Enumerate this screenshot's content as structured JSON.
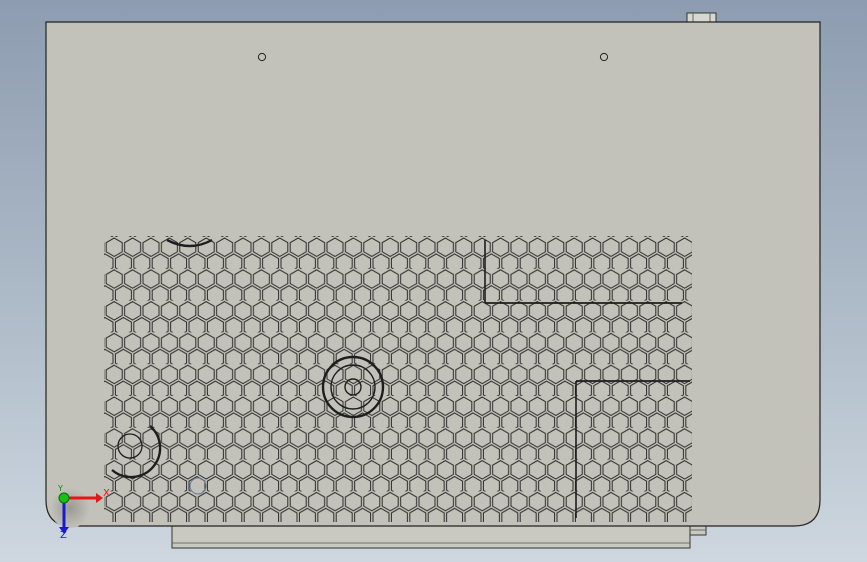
{
  "colors": {
    "background_top": "#8d9cb0",
    "background_bottom": "#ced7df",
    "part_face": "#c2c2ba",
    "edge": "#222222",
    "axis_x": "#e01818",
    "axis_y": "#0a8a0a",
    "axis_z": "#1a1ad0"
  },
  "triad": {
    "x_label": "X",
    "y_label": "Y",
    "z_label": "Z"
  }
}
